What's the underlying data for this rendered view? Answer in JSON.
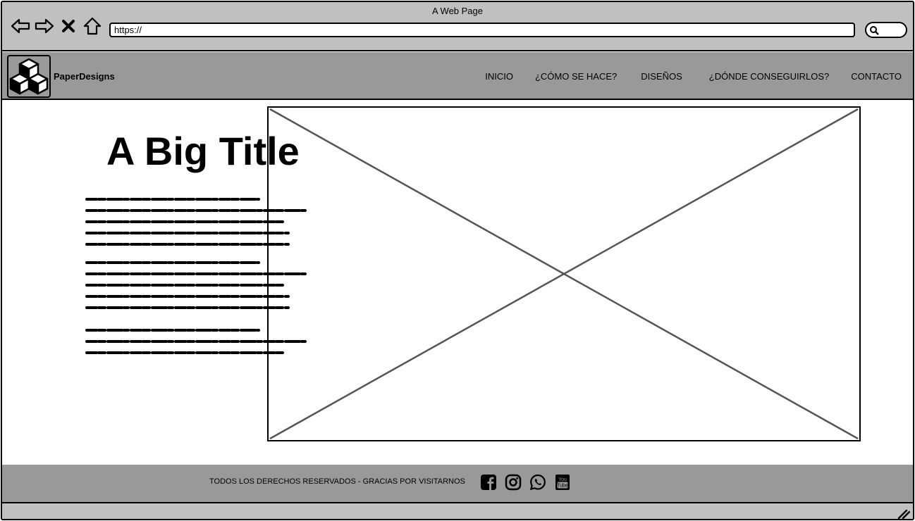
{
  "browser": {
    "title": "A Web Page",
    "url": "https://"
  },
  "header": {
    "brand": "PaperDesigns",
    "menu": [
      "INICIO",
      "¿CÓMO SE HACE?",
      "DISEÑOS",
      "¿DÓNDE CONSEGUIRLOS?",
      "CONTACTO"
    ]
  },
  "main": {
    "title": "A Big Title"
  },
  "footer": {
    "text": "TODOS LOS DERECHOS RESERVADOS - GRACIAS POR VISITARNOS",
    "social_icons": [
      "facebook-icon",
      "instagram-icon",
      "whatsapp-icon",
      "youtube-icon"
    ]
  },
  "colors": {
    "chrome": "#c0c0c0",
    "header": "#999999",
    "footer": "#999999"
  }
}
